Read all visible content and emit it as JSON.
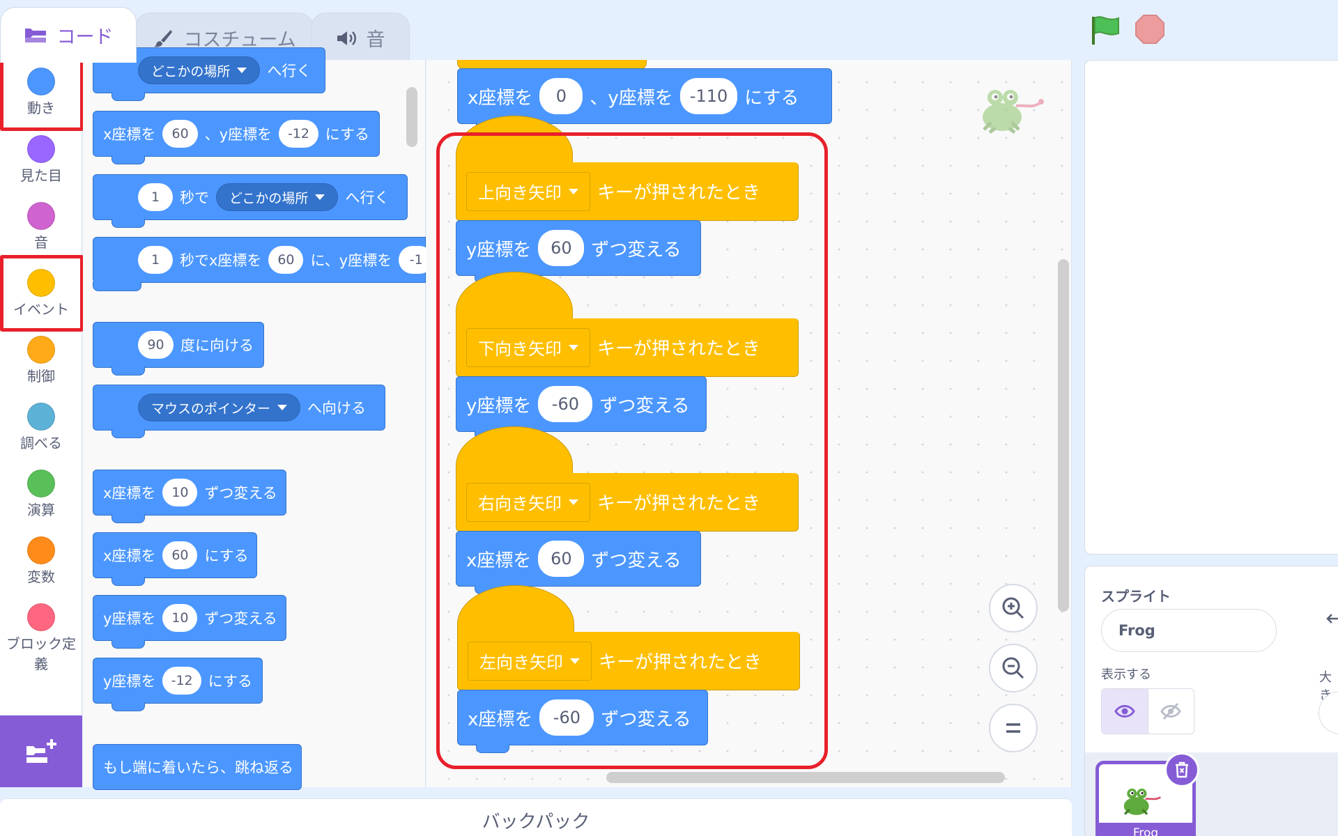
{
  "tabs": {
    "code": "コード",
    "costumes": "コスチューム",
    "sounds": "音"
  },
  "categories": [
    {
      "label": "動き",
      "color": "#4c97ff"
    },
    {
      "label": "見た目",
      "color": "#9966ff"
    },
    {
      "label": "音",
      "color": "#cf63cf"
    },
    {
      "label": "イベント",
      "color": "#ffbf00"
    },
    {
      "label": "制御",
      "color": "#ffab19"
    },
    {
      "label": "調べる",
      "color": "#5cb1d6"
    },
    {
      "label": "演算",
      "color": "#59c059"
    },
    {
      "label": "変数",
      "color": "#ff8c1a"
    },
    {
      "label": "ブロック定義",
      "color": "#ff6680"
    }
  ],
  "palette": {
    "goto_dd": "どこかの場所",
    "goto_suffix": "へ行く",
    "gotoxy": {
      "xlabel": "x座標を",
      "x": "60",
      "sep": "、y座標を",
      "y": "-12",
      "suffix": "にする"
    },
    "glide": {
      "secs": "1",
      "mid": "秒で",
      "dd": "どこかの場所",
      "suffix": "へ行く"
    },
    "glidexy": {
      "secs": "1",
      "mid": "秒でx座標を",
      "x": "60",
      "sep": "に、y座標を",
      "y": "-1"
    },
    "point_dir": {
      "deg": "90",
      "suffix": "度に向ける"
    },
    "point_towards": {
      "dd": "マウスのポインター",
      "suffix": "へ向ける"
    },
    "change_x": {
      "label": "x座標を",
      "v": "10",
      "suffix": "ずつ変える"
    },
    "set_x": {
      "label": "x座標を",
      "v": "60",
      "suffix": "にする"
    },
    "change_y": {
      "label": "y座標を",
      "v": "10",
      "suffix": "ずつ変える"
    },
    "set_y": {
      "label": "y座標を",
      "v": "-12",
      "suffix": "にする"
    },
    "bounce": "もし端に着いたら、跳ね返る"
  },
  "workspace": {
    "top_block": {
      "xlabel": "x座標を",
      "x": "0",
      "sep": "、y座標を",
      "y": "-110",
      "suffix": "にする"
    },
    "scripts": [
      {
        "key": "上向き矢印",
        "hat_suffix": "キーが押されたとき",
        "label": "y座標を",
        "v": "60",
        "suffix": "ずつ変える"
      },
      {
        "key": "下向き矢印",
        "hat_suffix": "キーが押されたとき",
        "label": "y座標を",
        "v": "-60",
        "suffix": "ずつ変える"
      },
      {
        "key": "右向き矢印",
        "hat_suffix": "キーが押されたとき",
        "label": "x座標を",
        "v": "60",
        "suffix": "ずつ変える"
      },
      {
        "key": "左向き矢印",
        "hat_suffix": "キーが押されたとき",
        "label": "x座標を",
        "v": "-60",
        "suffix": "ずつ変える"
      }
    ]
  },
  "backpack": "バックパック",
  "sprite_info": {
    "label": "スプライト",
    "name": "Frog",
    "show_label": "表示する",
    "size_label": "大き"
  },
  "sprite_list": [
    {
      "name": "Frog"
    }
  ],
  "colors": {
    "accent": "#855cd6",
    "motion": "#4c97ff",
    "events": "#ffbf00",
    "highlight": "#e8202a"
  }
}
